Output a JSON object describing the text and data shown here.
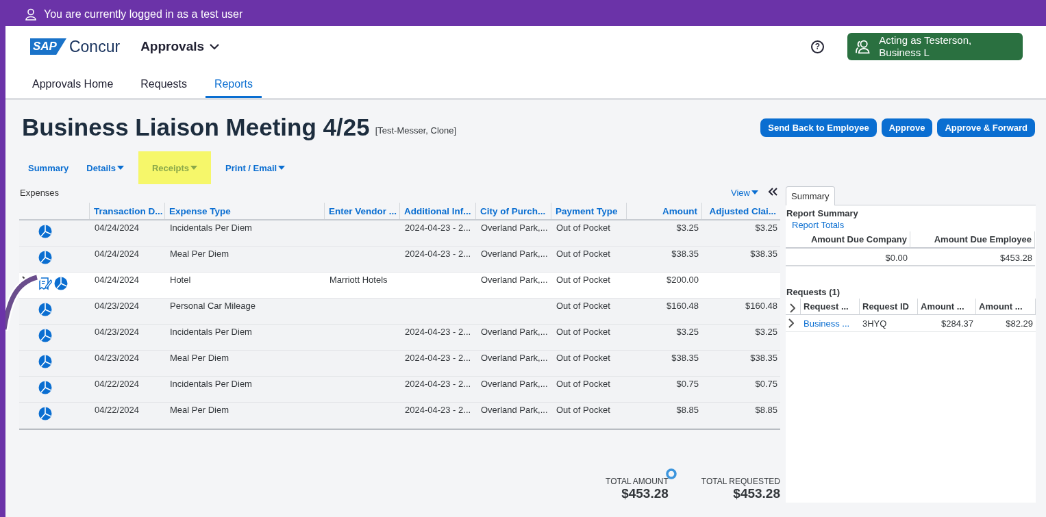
{
  "banner": {
    "text": "You are currently logged in as a test user"
  },
  "header": {
    "logo_mark": "SAP",
    "logo_name": "Concur",
    "app_menu": "Approvals",
    "help": "?",
    "acting_as": "Acting as Testerson, Business L"
  },
  "nav_tabs": [
    {
      "label": "Approvals Home",
      "selected": false
    },
    {
      "label": "Requests",
      "selected": false
    },
    {
      "label": "Reports",
      "selected": true
    }
  ],
  "report": {
    "title": "Business Liaison Meeting 4/25",
    "owner": "[Test-Messer, Clone]"
  },
  "actions": [
    "Send Back to Employee",
    "Approve",
    "Approve & Forward"
  ],
  "report_menu": [
    {
      "label": "Summary",
      "has_menu": false,
      "highlighted": false
    },
    {
      "label": "Details",
      "has_menu": true,
      "highlighted": false
    },
    {
      "label": "Receipts",
      "has_menu": true,
      "highlighted": true
    },
    {
      "label": "Print / Email",
      "has_menu": true,
      "highlighted": false
    }
  ],
  "expenses": {
    "title": "Expenses",
    "view": "View",
    "columns": [
      "Transaction D...",
      "Expense Type",
      "Enter Vendor ...",
      "Additional Inf...",
      "City of Purch...",
      "Payment Type",
      "Amount",
      "Adjusted Clai..."
    ],
    "rows": [
      {
        "expandable": false,
        "selected": false,
        "receipt": false,
        "date": "04/24/2024",
        "expense_type": "Incidentals Per Diem",
        "additional_info": "2024-04-23 - 2...",
        "city": "Overland Park,...",
        "payment_type": "Out of Pocket",
        "amount": "$3.25",
        "adjusted": "$3.25"
      },
      {
        "expandable": false,
        "selected": false,
        "receipt": false,
        "date": "04/24/2024",
        "expense_type": "Meal Per Diem",
        "additional_info": "2024-04-23 - 2...",
        "city": "Overland Park,...",
        "payment_type": "Out of Pocket",
        "amount": "$38.35",
        "adjusted": "$38.35"
      },
      {
        "expandable": true,
        "selected": true,
        "receipt": true,
        "date": "04/24/2024",
        "expense_type": "Hotel",
        "vendor": "Marriott Hotels",
        "city": "Overland Park,...",
        "payment_type": "Out of Pocket",
        "amount": "$200.00"
      },
      {
        "expandable": false,
        "selected": false,
        "receipt": false,
        "date": "04/23/2024",
        "expense_type": "Personal Car Mileage",
        "payment_type": "Out of Pocket",
        "amount": "$160.48",
        "adjusted": "$160.48"
      },
      {
        "expandable": false,
        "selected": false,
        "receipt": false,
        "date": "04/23/2024",
        "expense_type": "Incidentals Per Diem",
        "additional_info": "2024-04-23 - 2...",
        "city": "Overland Park,...",
        "payment_type": "Out of Pocket",
        "amount": "$3.25",
        "adjusted": "$3.25"
      },
      {
        "expandable": false,
        "selected": false,
        "receipt": false,
        "date": "04/23/2024",
        "expense_type": "Meal Per Diem",
        "additional_info": "2024-04-23 - 2...",
        "city": "Overland Park,...",
        "payment_type": "Out of Pocket",
        "amount": "$38.35",
        "adjusted": "$38.35"
      },
      {
        "expandable": false,
        "selected": false,
        "receipt": false,
        "date": "04/22/2024",
        "expense_type": "Incidentals Per Diem",
        "additional_info": "2024-04-23 - 2...",
        "city": "Overland Park,...",
        "payment_type": "Out of Pocket",
        "amount": "$0.75",
        "adjusted": "$0.75"
      },
      {
        "expandable": false,
        "selected": false,
        "receipt": false,
        "date": "04/22/2024",
        "expense_type": "Meal Per Diem",
        "additional_info": "2024-04-23 - 2...",
        "city": "Overland Park,...",
        "payment_type": "Out of Pocket",
        "amount": "$8.85",
        "adjusted": "$8.85"
      }
    ]
  },
  "totals": [
    {
      "label": "TOTAL AMOUNT",
      "value": "$453.28"
    },
    {
      "label": "TOTAL REQUESTED",
      "value": "$453.28"
    }
  ],
  "summary_panel": {
    "tabs": [
      {
        "label": "Summary",
        "selected": true
      }
    ],
    "heading": "Report Summary",
    "link": "Report Totals",
    "totals_table": {
      "columns": [
        "Amount Due Company",
        "Amount Due Employee"
      ],
      "rows": [
        [
          "$0.00",
          "$453.28"
        ]
      ]
    },
    "requests": {
      "heading": "Requests (1)",
      "columns": [
        "Request ...",
        "Request ID",
        "Amount ...",
        "Amount ..."
      ],
      "rows": [
        {
          "link": "Business ...",
          "id": "3HYQ",
          "amount_1": "$284.37",
          "amount_2": "$82.29"
        }
      ]
    }
  }
}
